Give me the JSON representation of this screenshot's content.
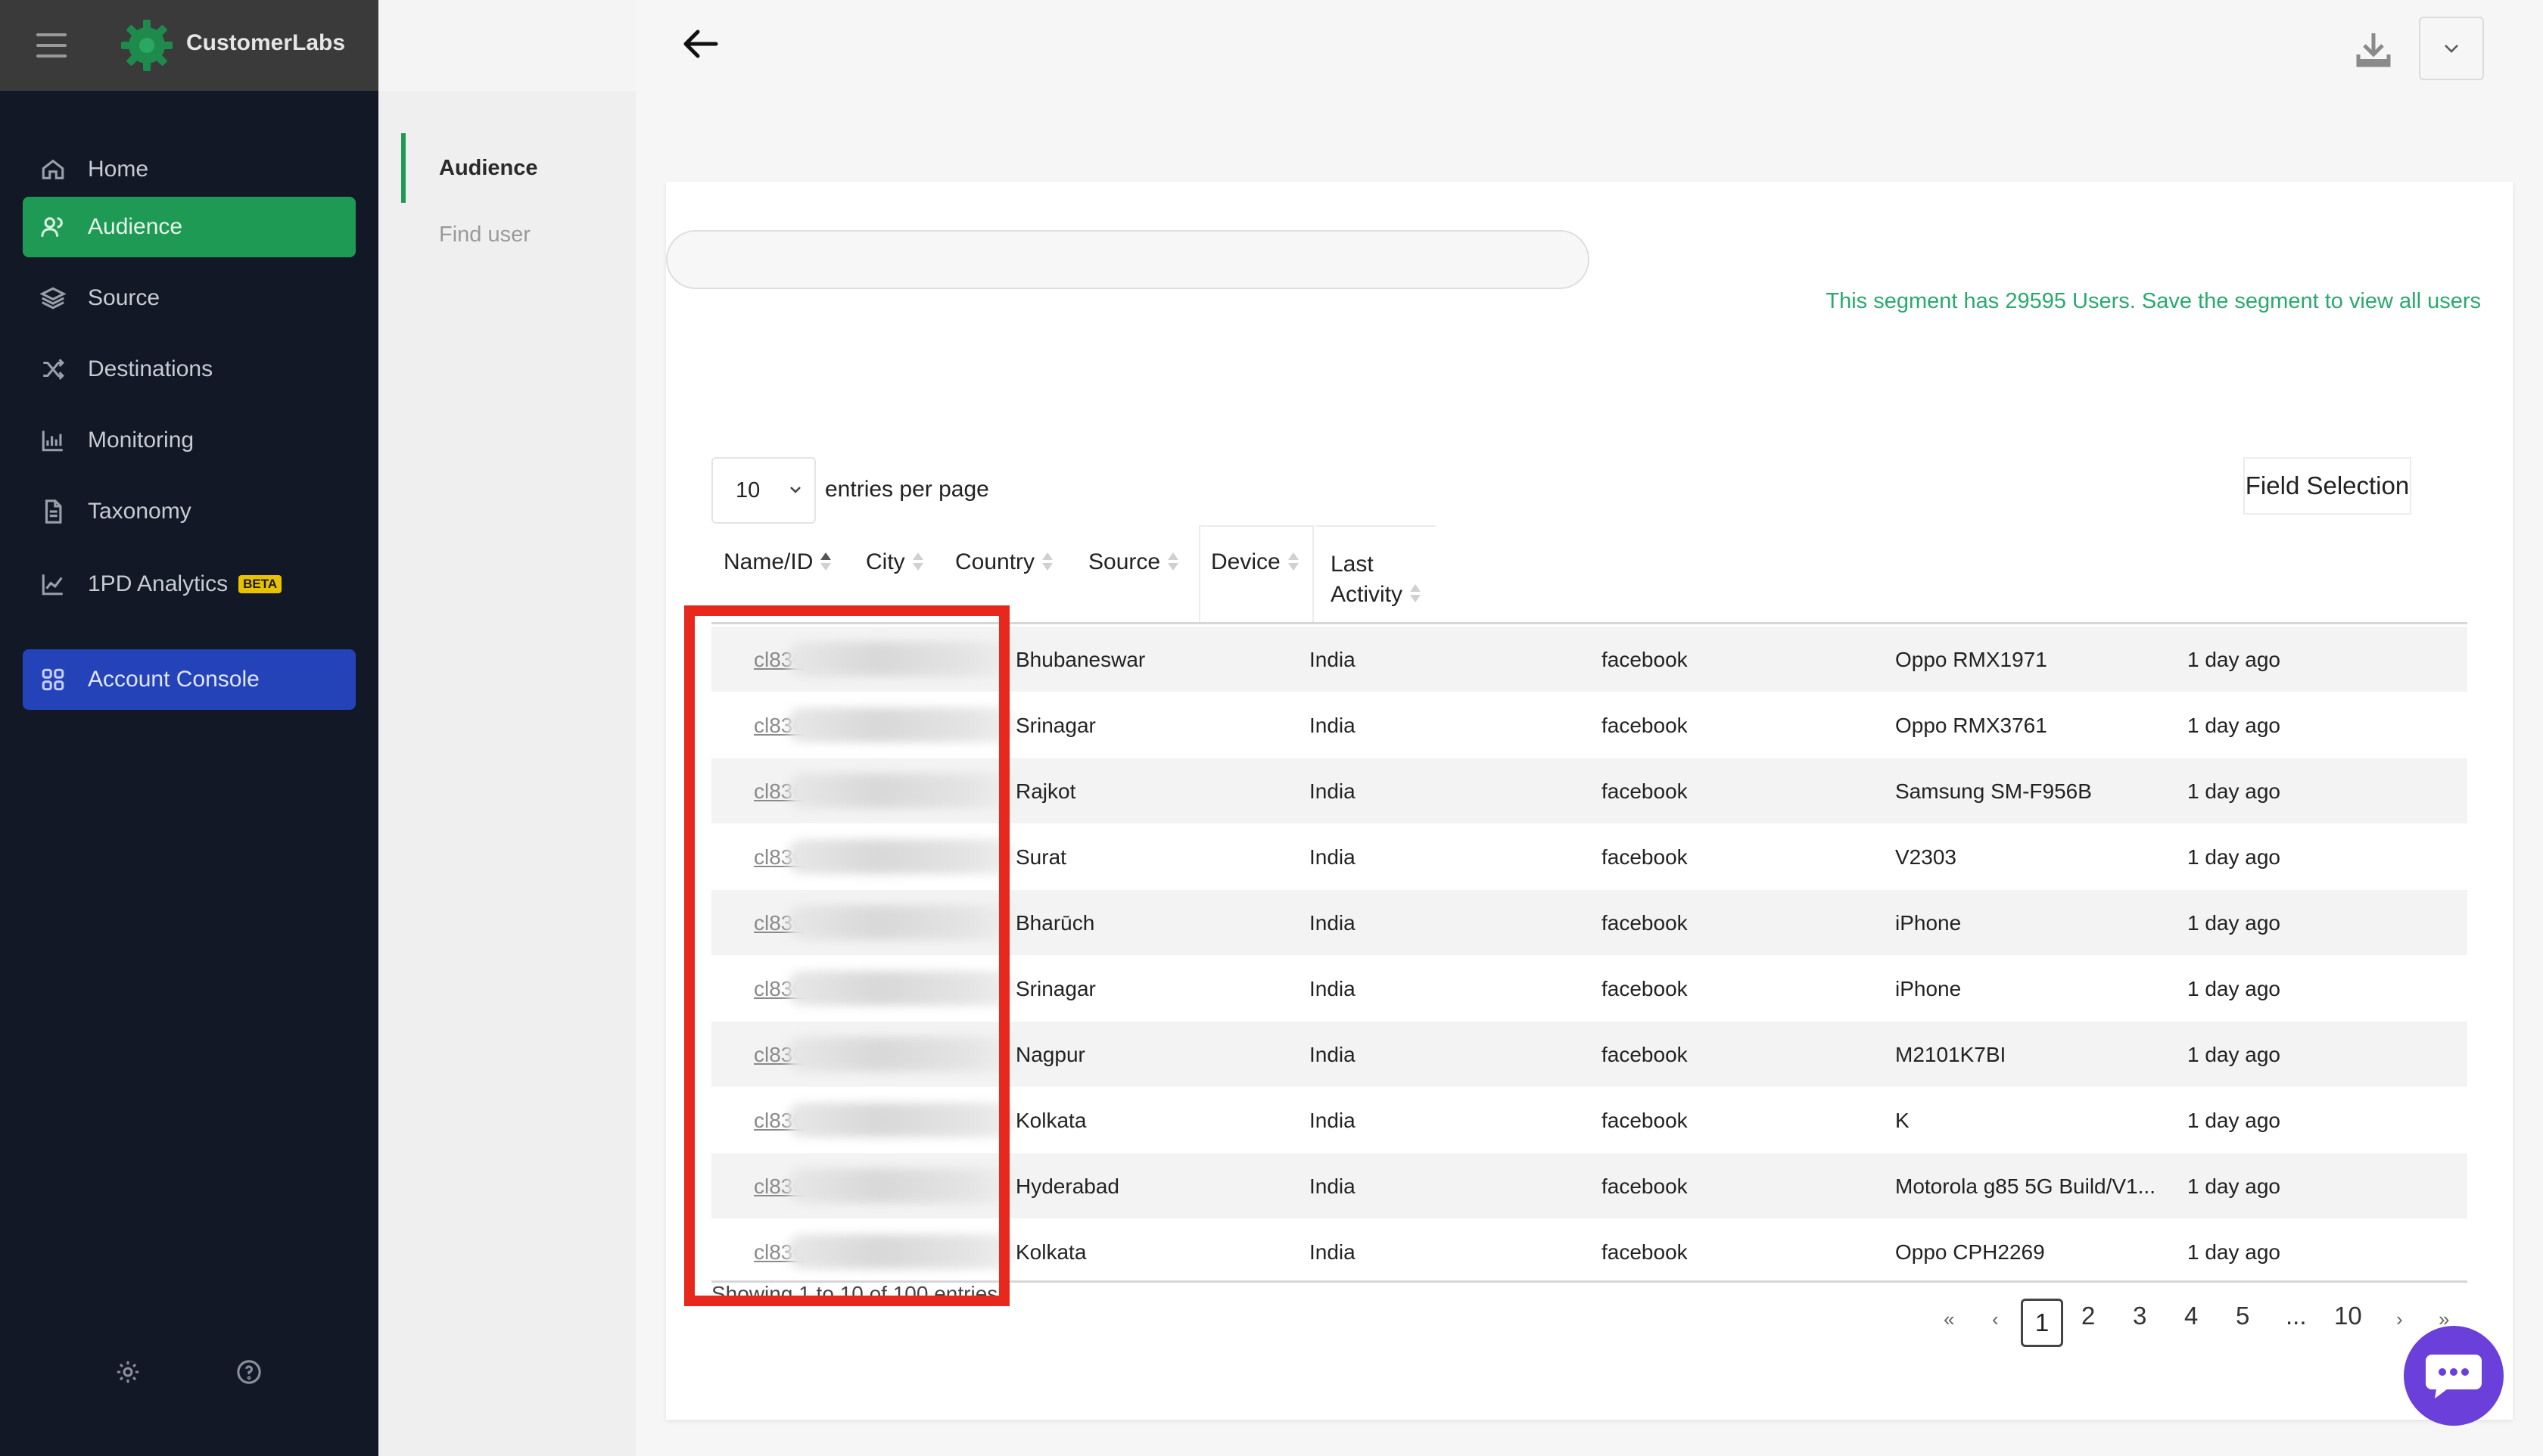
{
  "app": {
    "brand_name": "CustomerLabs"
  },
  "sidebar": {
    "items": [
      {
        "label": "Home",
        "icon": "home-icon"
      },
      {
        "label": "Audience",
        "icon": "users-icon",
        "active": true
      },
      {
        "label": "Source",
        "icon": "layers-icon"
      },
      {
        "label": "Destinations",
        "icon": "shuffle-icon"
      },
      {
        "label": "Monitoring",
        "icon": "bar-chart-icon"
      },
      {
        "label": "Taxonomy",
        "icon": "document-icon"
      },
      {
        "label": "1PD Analytics",
        "icon": "line-chart-icon",
        "badge": "BETA"
      }
    ],
    "account_console": "Account Console"
  },
  "subnav": {
    "audience": "Audience",
    "find_user": "Find user"
  },
  "main": {
    "search_placeholder": "",
    "segment_note": "This segment has 29595 Users. Save the segment to view all users",
    "entries_value": "10",
    "entries_label": "entries per page",
    "field_selection": "Field Selection"
  },
  "table": {
    "columns": [
      "Name/ID",
      "City",
      "Country",
      "Source",
      "Device",
      "Last",
      "Activity"
    ],
    "rows": [
      {
        "id": "cl83€",
        "city": "Bhubaneswar",
        "country": "India",
        "source": "facebook",
        "device": "Oppo RMX1971",
        "last": "1 day ago"
      },
      {
        "id": "cl83€",
        "city": "Srinagar",
        "country": "India",
        "source": "facebook",
        "device": "Oppo RMX3761",
        "last": "1 day ago"
      },
      {
        "id": "cl83€",
        "city": "Rajkot",
        "country": "India",
        "source": "facebook",
        "device": "Samsung SM-F956B",
        "last": "1 day ago"
      },
      {
        "id": "cl83€",
        "city": "Surat",
        "country": "India",
        "source": "facebook",
        "device": "V2303",
        "last": "1 day ago"
      },
      {
        "id": "cl83€",
        "city": "Bharūch",
        "country": "India",
        "source": "facebook",
        "device": "iPhone",
        "last": "1 day ago"
      },
      {
        "id": "cl83€",
        "city": "Srinagar",
        "country": "India",
        "source": "facebook",
        "device": "iPhone",
        "last": "1 day ago"
      },
      {
        "id": "cl83€",
        "city": "Nagpur",
        "country": "India",
        "source": "facebook",
        "device": "M2101K7BI",
        "last": "1 day ago"
      },
      {
        "id": "cl83€",
        "city": "Kolkata",
        "country": "India",
        "source": "facebook",
        "device": "K",
        "last": "1 day ago"
      },
      {
        "id": "cl83€",
        "city": "Hyderabad",
        "country": "India",
        "source": "facebook",
        "device": "Motorola g85 5G Build/V1...",
        "last": "1 day ago"
      },
      {
        "id": "cl83€",
        "city": "Kolkata",
        "country": "India",
        "source": "facebook",
        "device": "Oppo CPH2269",
        "last": "1 day ago"
      }
    ],
    "showing": "Showing 1 to 10 of 100 entries"
  },
  "pagination": {
    "first": "«",
    "prev": "‹",
    "pages": [
      "1",
      "2",
      "3",
      "4",
      "5"
    ],
    "ellipsis": "...",
    "last_page": "10",
    "next": "›",
    "last": "»",
    "current": "1"
  },
  "colors": {
    "sidebar_bg": "#121826",
    "active_green": "#1f9a55",
    "console_blue": "#2443b8",
    "highlight_red": "#e8281c",
    "note_green": "#2aa96f",
    "chat_purple": "#6b3fd9"
  }
}
